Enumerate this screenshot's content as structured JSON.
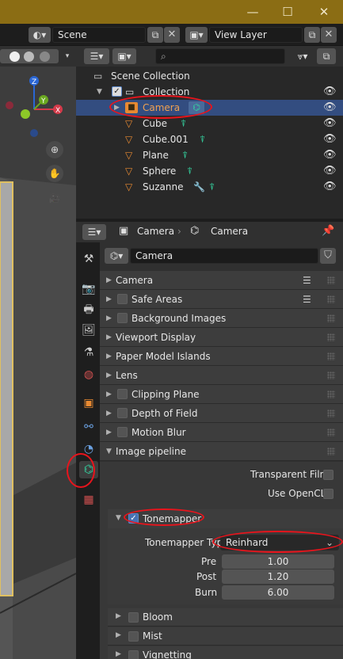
{
  "topbar": {
    "scene": "Scene",
    "view_layer": "View Layer"
  },
  "outliner": {
    "collection_root": "Scene Collection",
    "collection": "Collection",
    "objects": [
      "Camera",
      "Cube",
      "Cube.001",
      "Plane",
      "Sphere",
      "Suzanne"
    ]
  },
  "properties": {
    "breadcrumb_object": "Camera",
    "breadcrumb_data": "Camera",
    "datablock_name": "Camera",
    "panels": [
      "Camera",
      "Safe Areas",
      "Background Images",
      "Viewport Display",
      "Paper Model Islands",
      "Lens",
      "Clipping Plane",
      "Depth of Field",
      "Motion Blur",
      "Image pipeline"
    ],
    "image_pipeline": {
      "transparent_film": "Transparent Film",
      "use_opencl": "Use OpenCL",
      "tonemapper": "Tonemapper",
      "tonemapper_type_label": "Tonemapper Type",
      "tonemapper_type_value": "Reinhard",
      "pre_label": "Pre",
      "pre_value": "1.00",
      "post_label": "Post",
      "post_value": "1.20",
      "burn_label": "Burn",
      "burn_value": "6.00"
    },
    "subpanels": [
      "Bloom",
      "Mist",
      "Vignetting"
    ]
  },
  "colors": {
    "titlebar": "#8b6d14",
    "selection": "#334d80",
    "accent": "#4772b3",
    "annotation": "#e8141c"
  }
}
